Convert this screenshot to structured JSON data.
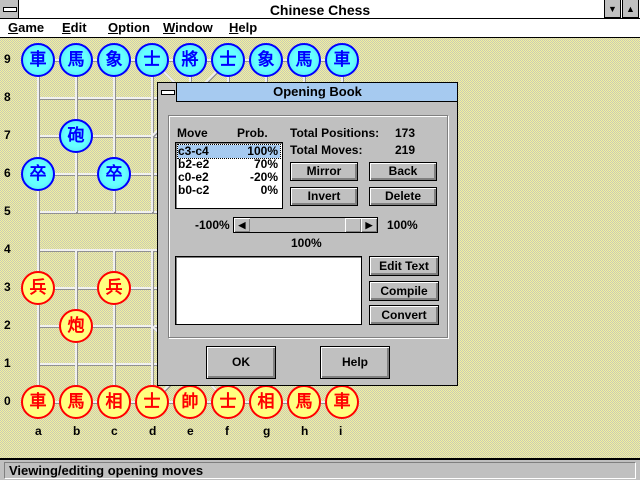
{
  "window": {
    "title": "Chinese Chess"
  },
  "menu": [
    {
      "label": "Game",
      "u": "G",
      "rest": "ame"
    },
    {
      "label": "Edit",
      "u": "E",
      "rest": "dit"
    },
    {
      "label": "Option",
      "u": "O",
      "rest": "ption"
    },
    {
      "label": "Window",
      "u": "W",
      "rest": "indow"
    },
    {
      "label": "Help",
      "u": "H",
      "rest": "elp"
    }
  ],
  "board": {
    "files": [
      "a",
      "b",
      "c",
      "d",
      "e",
      "f",
      "g",
      "h",
      "i"
    ],
    "ranks": [
      "0",
      "1",
      "2",
      "3",
      "4",
      "5",
      "6",
      "7",
      "8",
      "9"
    ],
    "pieces": [
      {
        "file": 0,
        "rank": 9,
        "char": "車",
        "side": "blue"
      },
      {
        "file": 1,
        "rank": 9,
        "char": "馬",
        "side": "blue"
      },
      {
        "file": 2,
        "rank": 9,
        "char": "象",
        "side": "blue"
      },
      {
        "file": 3,
        "rank": 9,
        "char": "士",
        "side": "blue"
      },
      {
        "file": 4,
        "rank": 9,
        "char": "將",
        "side": "blue"
      },
      {
        "file": 5,
        "rank": 9,
        "char": "士",
        "side": "blue"
      },
      {
        "file": 6,
        "rank": 9,
        "char": "象",
        "side": "blue"
      },
      {
        "file": 7,
        "rank": 9,
        "char": "馬",
        "side": "blue"
      },
      {
        "file": 8,
        "rank": 9,
        "char": "車",
        "side": "blue"
      },
      {
        "file": 1,
        "rank": 7,
        "char": "砲",
        "side": "blue"
      },
      {
        "file": 0,
        "rank": 6,
        "char": "卒",
        "side": "blue"
      },
      {
        "file": 2,
        "rank": 6,
        "char": "卒",
        "side": "blue"
      },
      {
        "file": 0,
        "rank": 3,
        "char": "兵",
        "side": "red"
      },
      {
        "file": 2,
        "rank": 3,
        "char": "兵",
        "side": "red"
      },
      {
        "file": 1,
        "rank": 2,
        "char": "炮",
        "side": "red"
      },
      {
        "file": 0,
        "rank": 0,
        "char": "車",
        "side": "red"
      },
      {
        "file": 1,
        "rank": 0,
        "char": "馬",
        "side": "red"
      },
      {
        "file": 2,
        "rank": 0,
        "char": "相",
        "side": "red"
      },
      {
        "file": 3,
        "rank": 0,
        "char": "士",
        "side": "red"
      },
      {
        "file": 4,
        "rank": 0,
        "char": "帥",
        "side": "red"
      },
      {
        "file": 5,
        "rank": 0,
        "char": "士",
        "side": "red"
      },
      {
        "file": 6,
        "rank": 0,
        "char": "相",
        "side": "red"
      },
      {
        "file": 7,
        "rank": 0,
        "char": "馬",
        "side": "red"
      },
      {
        "file": 8,
        "rank": 0,
        "char": "車",
        "side": "red"
      }
    ]
  },
  "dialog": {
    "title": "Opening Book",
    "col_move": "Move",
    "col_prob": "Prob.",
    "moves": [
      {
        "move": "c3-c4",
        "prob": "100%",
        "selected": true
      },
      {
        "move": "b2-e2",
        "prob": "70%"
      },
      {
        "move": "c0-e2",
        "prob": "-20%"
      },
      {
        "move": "b0-c2",
        "prob": "0%"
      }
    ],
    "total_positions_label": "Total Positions:",
    "total_positions": "173",
    "total_moves_label": "Total Moves:",
    "total_moves": "219",
    "buttons": {
      "mirror": "Mirror",
      "back": "Back",
      "invert": "Invert",
      "delete": "Delete",
      "edit_text": "Edit Text",
      "compile": "Compile",
      "convert": "Convert",
      "ok": "OK",
      "help": "Help"
    },
    "slider": {
      "min_label": "-100%",
      "max_label": "100%",
      "value_label": "100%",
      "value": 100
    },
    "notes": ""
  },
  "status": "Viewing/editing opening moves"
}
